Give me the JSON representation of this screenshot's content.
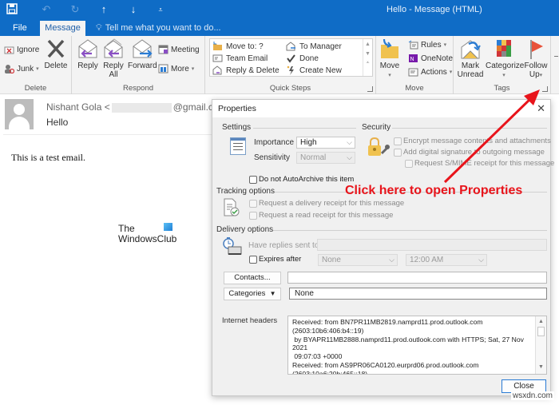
{
  "window": {
    "title": "Hello - Message (HTML)",
    "qat_icons": [
      "save-icon",
      "undo-icon",
      "redo-icon",
      "up-arrow-icon",
      "down-arrow-icon",
      "customize-qat-icon"
    ]
  },
  "tabs": {
    "file": "File",
    "message": "Message",
    "tell_me": "Tell me what you want to do..."
  },
  "ribbon": {
    "delete_group": {
      "label": "Delete",
      "ignore": "Ignore",
      "junk": "Junk",
      "delete": "Delete"
    },
    "respond_group": {
      "label": "Respond",
      "reply": "Reply",
      "reply_all_1": "Reply",
      "reply_all_2": "All",
      "forward": "Forward",
      "meeting": "Meeting",
      "more": "More"
    },
    "quick_steps_group": {
      "label": "Quick Steps",
      "items": [
        "Move to: ?",
        "Team Email",
        "Reply & Delete",
        "To Manager",
        "Done",
        "Create New"
      ]
    },
    "move_group": {
      "label": "Move",
      "move": "Move",
      "rules": "Rules",
      "onenote": "OneNote",
      "actions": "Actions"
    },
    "tags_group": {
      "label": "Tags",
      "mark_unread_1": "Mark",
      "mark_unread_2": "Unread",
      "categorize": "Categorize",
      "follow_up_1": "Follow",
      "follow_up_2": "Up"
    }
  },
  "message": {
    "sender_name": "Nishant Gola <",
    "sender_domain": "@gmail.co",
    "subject": "Hello",
    "body": "This is a test email.",
    "watermark_line1": "The",
    "watermark_line2": "WindowsClub"
  },
  "dialog": {
    "title": "Properties",
    "settings": {
      "label": "Settings",
      "importance_label": "Importance",
      "importance_value": "High",
      "sensitivity_label": "Sensitivity",
      "sensitivity_value": "Normal",
      "autoarchive": "Do not AutoArchive this item"
    },
    "security": {
      "label": "Security",
      "encrypt": "Encrypt message contents and attachments",
      "signature": "Add digital signature to outgoing message",
      "smime": "Request S/MIME receipt for this message"
    },
    "tracking": {
      "label": "Tracking options",
      "delivery": "Request a delivery receipt for this message",
      "read": "Request a read receipt for this message"
    },
    "delivery": {
      "label": "Delivery options",
      "replies_label": "Have replies sent to",
      "replies_value": "",
      "expires_label": "Expires after",
      "expires_date": "None",
      "expires_time": "12:00 AM"
    },
    "contacts_button": "Contacts...",
    "contacts_value": "",
    "categories_button": "Categories",
    "categories_value": "None",
    "headers_label": "Internet headers",
    "headers_lines": [
      "Received: from BN7PR11MB2819.namprd11.prod.outlook.com",
      "(2603:10b6:406:b4::19)",
      " by BYAPR11MB2888.namprd11.prod.outlook.com with HTTPS; Sat, 27 Nov",
      "2021",
      " 09:07:03 +0000",
      "Received: from AS9PR06CA0120.eurprd06.prod.outlook.com",
      "(2603:10a6:20b:465::18)"
    ],
    "close_button": "Close"
  },
  "annotation": {
    "text": "Click here to open Properties",
    "color": "#e8141b"
  },
  "site_watermark": "wsxdn.com"
}
